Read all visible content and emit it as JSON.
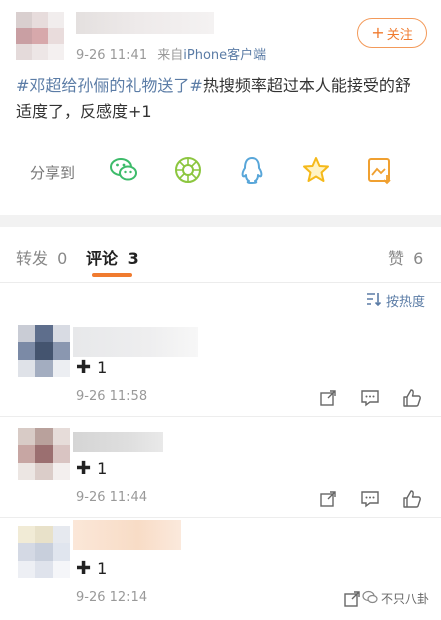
{
  "post": {
    "meta_time": "9-26 11:41",
    "meta_source_prefix": "来自",
    "meta_source": "iPhone客户端",
    "follow_label": "关注",
    "topic": "#邓超给孙俪的礼物送了#",
    "body": "热搜频率超过本人能接受的舒适度了，反感度+1",
    "share_label": "分享到",
    "share_icons": [
      "wechat-icon",
      "moments-icon",
      "qq-icon",
      "favorite-star-icon",
      "save-image-icon"
    ]
  },
  "tabs": {
    "repost_label": "转发",
    "repost_count": "0",
    "comment_label": "评论",
    "comment_count": "3",
    "like_label": "赞",
    "like_count": "6"
  },
  "sort": {
    "label": "按热度"
  },
  "comments": [
    {
      "text": "1",
      "time": "9-26 11:58"
    },
    {
      "text": "1",
      "time": "9-26 11:44"
    },
    {
      "text": "1",
      "time": "9-26 12:14"
    }
  ],
  "watermark": {
    "label": "不只八卦"
  },
  "colors": {
    "accent": "#f07b2f",
    "link": "#5b7ca6",
    "share_green": "#3dbb6a",
    "star": "#f5b91a"
  }
}
